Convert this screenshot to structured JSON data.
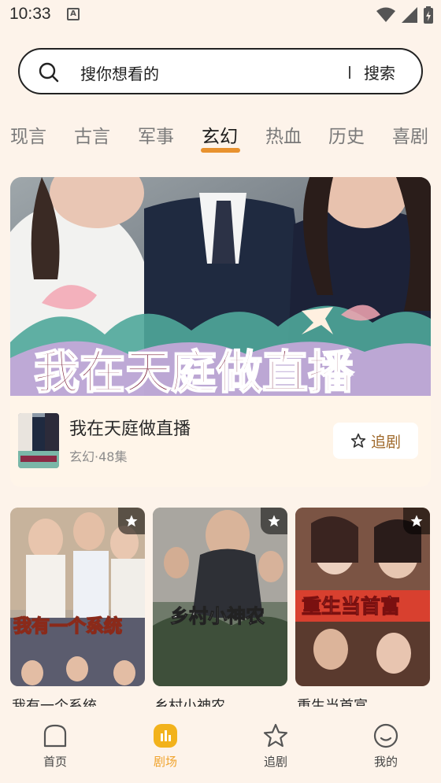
{
  "status_bar": {
    "time": "10:33",
    "notification_icon": "A"
  },
  "search": {
    "placeholder": "搜你想看的",
    "button": "搜索"
  },
  "tabs": [
    {
      "label": "现言",
      "active": false
    },
    {
      "label": "古言",
      "active": false
    },
    {
      "label": "军事",
      "active": false
    },
    {
      "label": "玄幻",
      "active": true
    },
    {
      "label": "热血",
      "active": false
    },
    {
      "label": "历史",
      "active": false
    },
    {
      "label": "喜剧",
      "active": false
    }
  ],
  "banner": {
    "poster_text": "我在天庭做直播",
    "title": "我在天庭做直播",
    "meta": "玄幻·48集",
    "follow_label": "追剧"
  },
  "cards": [
    {
      "title": "我有一个系统",
      "poster_text": "我有一个系统"
    },
    {
      "title": "乡村小神农",
      "poster_text": "乡村小神农"
    },
    {
      "title": "重生当首富",
      "poster_text": "重生当首富"
    }
  ],
  "bottom_nav": [
    {
      "label": "首页",
      "icon": "home-icon",
      "active": false
    },
    {
      "label": "剧场",
      "icon": "theater-icon",
      "active": true
    },
    {
      "label": "追剧",
      "icon": "star-icon",
      "active": false
    },
    {
      "label": "我的",
      "icon": "profile-icon",
      "active": false
    }
  ],
  "colors": {
    "accent": "#e8922f",
    "background": "#fdf3ea",
    "active_nav": "#f0a32c"
  }
}
